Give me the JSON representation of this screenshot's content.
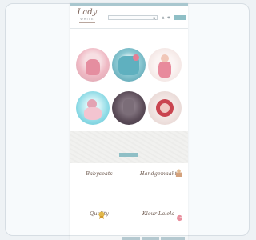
{
  "top_strip": {
    "text": ""
  },
  "logo": {
    "name": "Lady",
    "sub": "WHITE"
  },
  "search": {
    "placeholder": ""
  },
  "cart": {
    "label": ""
  },
  "nav": {
    "items": [
      "",
      "",
      "",
      "",
      "",
      "",
      "",
      "",
      ""
    ]
  },
  "tagline": "",
  "categories": [
    {
      "label": "",
      "color": "#f3c9d0"
    },
    {
      "label": "",
      "color": "#6fb4c2"
    },
    {
      "label": "",
      "color": "#f4e8e6"
    },
    {
      "label": "",
      "color": "#a9e3ec"
    },
    {
      "label": "",
      "color": "#6a5a66"
    },
    {
      "label": "",
      "color": "#e9d9d6"
    }
  ],
  "banner": {
    "line1": "",
    "line2": "",
    "button": ""
  },
  "features": [
    {
      "title": "Babyseats",
      "desc": ""
    },
    {
      "title": "Handgemaakt",
      "desc": ""
    },
    {
      "title": "Quality",
      "desc": ""
    },
    {
      "title": "Kleur Lalela",
      "desc": ""
    }
  ],
  "cookie": {
    "text": "",
    "buttons": [
      "",
      "",
      ""
    ]
  },
  "colors": {
    "accent": "#8fbfc6",
    "brand_brown": "#7a6157"
  }
}
